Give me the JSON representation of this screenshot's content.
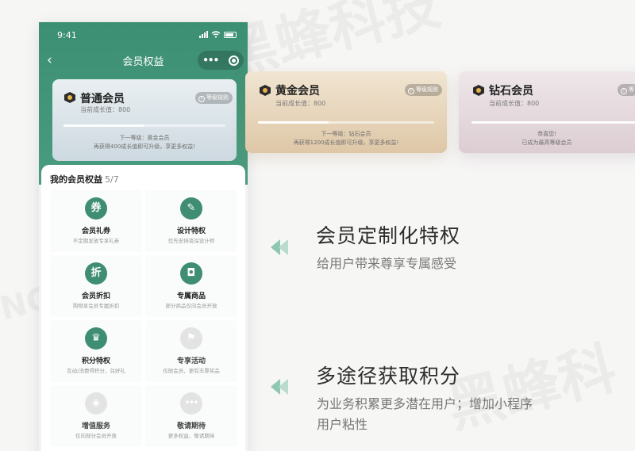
{
  "status_bar": {
    "time": "9:41"
  },
  "nav": {
    "back_icon": "chevron-left-icon",
    "title": "会员权益",
    "more": "•••"
  },
  "tiers": [
    {
      "name": "普通会员",
      "growth": "当前成长值：800",
      "rules": "等级规则",
      "progress": 0.5,
      "next": "下一等级：黄金会员",
      "tip": "再获得400成长值即可升级，享更多权益!"
    },
    {
      "name": "黄金会员",
      "growth": "当前成长值：800",
      "rules": "等级规则",
      "progress": 0.4,
      "next": "下一等级：钻石会员",
      "tip": "再获得1200成长值即可升级，享更多权益!"
    },
    {
      "name": "钻石会员",
      "growth": "当前成长值：800",
      "rules": "等",
      "progress": 1.0,
      "next": "恭喜您!",
      "tip": "已成为最高等级会员"
    }
  ],
  "rights": {
    "title": "我的会员权益",
    "count": "5/7",
    "items": [
      {
        "name": "会员礼券",
        "desc": "不定期发放专享礼券",
        "icon": "ticket-icon",
        "glyph": "券",
        "active": true
      },
      {
        "name": "设计特权",
        "desc": "优先安排资深设计师",
        "icon": "pencil-ruler-icon",
        "glyph": "✎",
        "active": true
      },
      {
        "name": "会员折扣",
        "desc": "购物享会员专属折扣",
        "icon": "discount-icon",
        "glyph": "折",
        "active": true
      },
      {
        "name": "专属商品",
        "desc": "部分商品仅向会员开放",
        "icon": "shopping-bag-icon",
        "glyph": "◘",
        "active": true
      },
      {
        "name": "积分特权",
        "desc": "互动/消费得积分，兑好礼",
        "icon": "crown-icon",
        "glyph": "♛",
        "active": true
      },
      {
        "name": "专享活动",
        "desc": "仅限会员，更有丰厚奖品",
        "icon": "flag-icon",
        "glyph": "⚑",
        "active": false
      },
      {
        "name": "增值服务",
        "desc": "仅向部分会员开放",
        "icon": "box-icon",
        "glyph": "◈",
        "active": false
      },
      {
        "name": "敬请期待",
        "desc": "更多权益，敬请期待",
        "icon": "more-icon",
        "glyph": "•••",
        "active": false
      }
    ]
  },
  "features": [
    {
      "title": "会员定制化特权",
      "lines": [
        "给用户带来尊享专属感受"
      ]
    },
    {
      "title": "多途径获取积分",
      "lines": [
        "为业务积累更多潜在用户；增加小程序",
        "用户粘性"
      ]
    }
  ],
  "colors": {
    "brand_green": "#3f8d72",
    "arrow_green": "#8fc6b4"
  }
}
